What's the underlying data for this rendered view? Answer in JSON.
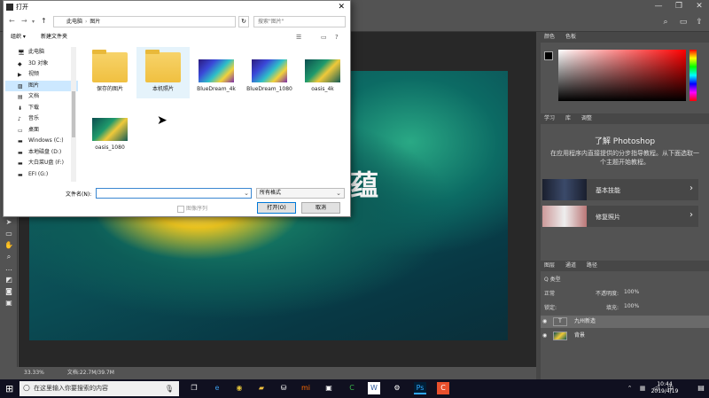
{
  "dialog": {
    "title": "打开",
    "address": [
      "此电脑",
      "图片"
    ],
    "search_placeholder": "搜索\"图片\"",
    "organize": "组织 ▾",
    "new_folder": "新建文件夹",
    "sidebar_items": [
      {
        "icon": "computer-icon",
        "label": "此电脑",
        "selected": false
      },
      {
        "icon": "cube-icon",
        "label": "3D 对象",
        "selected": false
      },
      {
        "icon": "video-icon",
        "label": "视频",
        "selected": false
      },
      {
        "icon": "picture-icon",
        "label": "图片",
        "selected": true
      },
      {
        "icon": "document-icon",
        "label": "文档",
        "selected": false
      },
      {
        "icon": "download-icon",
        "label": "下载",
        "selected": false
      },
      {
        "icon": "music-icon",
        "label": "音乐",
        "selected": false
      },
      {
        "icon": "desktop-icon",
        "label": "桌面",
        "selected": false
      },
      {
        "icon": "drive-icon",
        "label": "Windows (C:)",
        "selected": false
      },
      {
        "icon": "drive-icon",
        "label": "本地磁盘 (D:)",
        "selected": false
      },
      {
        "icon": "drive-icon",
        "label": "大白菜U盘 (F:)",
        "selected": false
      },
      {
        "icon": "drive-icon",
        "label": "EFI (G:)",
        "selected": false
      }
    ],
    "files": [
      {
        "name": "保存的图片",
        "kind": "folder"
      },
      {
        "name": "本机照片",
        "kind": "folder"
      },
      {
        "name": "BlueDream_4k",
        "kind": "image-blue"
      },
      {
        "name": "BlueDream_1080",
        "kind": "image-blue"
      },
      {
        "name": "oasis_4k",
        "kind": "image-oasis"
      },
      {
        "name": "oasis_1080",
        "kind": "image-oasis"
      }
    ],
    "filename_label": "文件名(N):",
    "filename_value": "",
    "filetype": "所有格式",
    "image_sequence": "图像序列",
    "open_button": "打开(O)",
    "cancel_button": "取消"
  },
  "photoshop": {
    "canvas_text": "蕴",
    "status_zoom": "33.33%",
    "status_doc": "文档:22.7M/39.7M",
    "color_tabs": [
      "颜色",
      "色板"
    ],
    "learn_tabs": [
      "学习",
      "库",
      "调整"
    ],
    "learn_title": "了解 Photoshop",
    "learn_desc": "在应用程序内直接提供的分步指导教程。从下面选取一个主题开始教程。",
    "learn_cards": [
      "基本技能",
      "修复照片"
    ],
    "layers_tabs": [
      "图层",
      "通道",
      "路径"
    ],
    "layers_kind": "Q 类型",
    "blend_mode": "正常",
    "opacity_label": "不透明度:",
    "opacity_value": "100%",
    "lock_label": "锁定:",
    "fill_label": "填充:",
    "fill_value": "100%",
    "layers": [
      {
        "name": "九州新造",
        "thumb": "T"
      },
      {
        "name": "背景",
        "thumb": ""
      }
    ]
  },
  "taskbar": {
    "search_text": "在这里输入你要搜索的内容",
    "time": "10:44",
    "date": "2019/4/19"
  }
}
